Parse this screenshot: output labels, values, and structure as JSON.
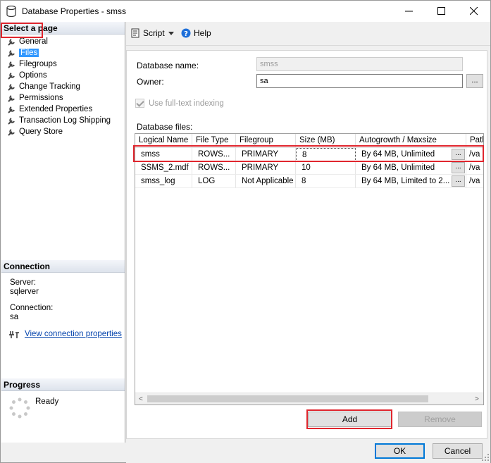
{
  "window": {
    "title": "Database Properties - smss"
  },
  "left_pane": {
    "select_page_header": "Select a page",
    "pages": [
      {
        "label": "General",
        "selected": false
      },
      {
        "label": "Files",
        "selected": true
      },
      {
        "label": "Filegroups",
        "selected": false
      },
      {
        "label": "Options",
        "selected": false
      },
      {
        "label": "Change Tracking",
        "selected": false
      },
      {
        "label": "Permissions",
        "selected": false
      },
      {
        "label": "Extended Properties",
        "selected": false
      },
      {
        "label": "Transaction Log Shipping",
        "selected": false
      },
      {
        "label": "Query Store",
        "selected": false
      }
    ],
    "connection": {
      "header": "Connection",
      "server_label": "Server:",
      "server_value": "sqlerver",
      "connection_label": "Connection:",
      "connection_value": "sa",
      "view_link": "View connection properties"
    },
    "progress": {
      "header": "Progress",
      "status": "Ready"
    }
  },
  "toolbar": {
    "script_label": "Script",
    "help_label": "Help"
  },
  "form": {
    "database_name_label": "Database name:",
    "database_name_value": "smss",
    "owner_label": "Owner:",
    "owner_value": "sa",
    "ellipsis": "...",
    "fulltext_label": "Use full-text indexing",
    "fulltext_checked": true,
    "database_files_label": "Database files:"
  },
  "files_grid": {
    "columns": [
      "Logical Name",
      "File Type",
      "Filegroup",
      "Size (MB)",
      "Autogrowth / Maxsize",
      "Path"
    ],
    "rows": [
      {
        "logical_name": "smss",
        "file_type": "ROWS...",
        "filegroup": "PRIMARY",
        "size": "8",
        "autogrowth": "By 64 MB, Unlimited",
        "path": "/va"
      },
      {
        "logical_name": "SSMS_2.mdf",
        "file_type": "ROWS...",
        "filegroup": "PRIMARY",
        "size": "10",
        "autogrowth": "By 64 MB, Unlimited",
        "path": "/va"
      },
      {
        "logical_name": "smss_log",
        "file_type": "LOG",
        "filegroup": "Not Applicable",
        "size": "8",
        "autogrowth": "By 64 MB, Limited to 2...",
        "path": "/va"
      }
    ],
    "cell_button": "..."
  },
  "buttons": {
    "add": "Add",
    "remove": "Remove",
    "ok": "OK",
    "cancel": "Cancel"
  },
  "colors": {
    "highlight_red": "#e0262e",
    "selection_blue": "#3399ff",
    "link_blue": "#0645ad"
  }
}
